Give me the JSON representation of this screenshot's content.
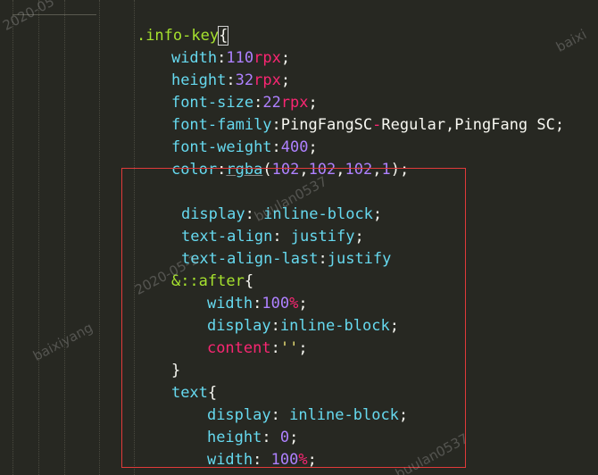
{
  "watermarks": {
    "top_left": "2020-05",
    "top_right": "baixi",
    "left_mid": "baixiyang",
    "mid_date": "2020-05-1",
    "mid_user": "buulan0537",
    "bottom_user": "buulan0537"
  },
  "code": {
    "selector": ".info-key",
    "open_brace": "{",
    "close_brace": "}",
    "properties": [
      {
        "name": "width",
        "value": "110",
        "unit": "rpx"
      },
      {
        "name": "height",
        "value": "32",
        "unit": "rpx"
      },
      {
        "name": "font-size",
        "value": "22",
        "unit": "rpx"
      },
      {
        "name": "font-family",
        "value_a": "PingFangSC",
        "dash": "-",
        "value_b": "Regular,PingFang SC"
      },
      {
        "name": "font-weight",
        "value": "400"
      },
      {
        "name": "color",
        "fn": "rgba",
        "args": [
          "102",
          "102",
          "102",
          "1"
        ]
      }
    ],
    "box_props": [
      {
        "name": "display",
        "value": "inline-block"
      },
      {
        "name": "text-align",
        "value": "justify"
      },
      {
        "name": "text-align-last",
        "value": "justify"
      }
    ],
    "after_selector": "&::after",
    "after_props": {
      "width_name": "width",
      "width_value": "100",
      "width_unit": "%",
      "display_name": "display",
      "display_value": "inline-block",
      "content_name": "content",
      "content_value": "''"
    },
    "text_selector": "text",
    "text_props": {
      "display_name": "display",
      "display_value": "inline-block",
      "height_name": "height",
      "height_value": "0",
      "width_name": "width",
      "width_value": "100",
      "width_unit": "%"
    }
  },
  "colors": {
    "background": "#272822",
    "selector": "#a6e22e",
    "property": "#66d9ef",
    "number": "#ae81ff",
    "unit": "#f92672",
    "highlight_box": "#e03a3a"
  }
}
